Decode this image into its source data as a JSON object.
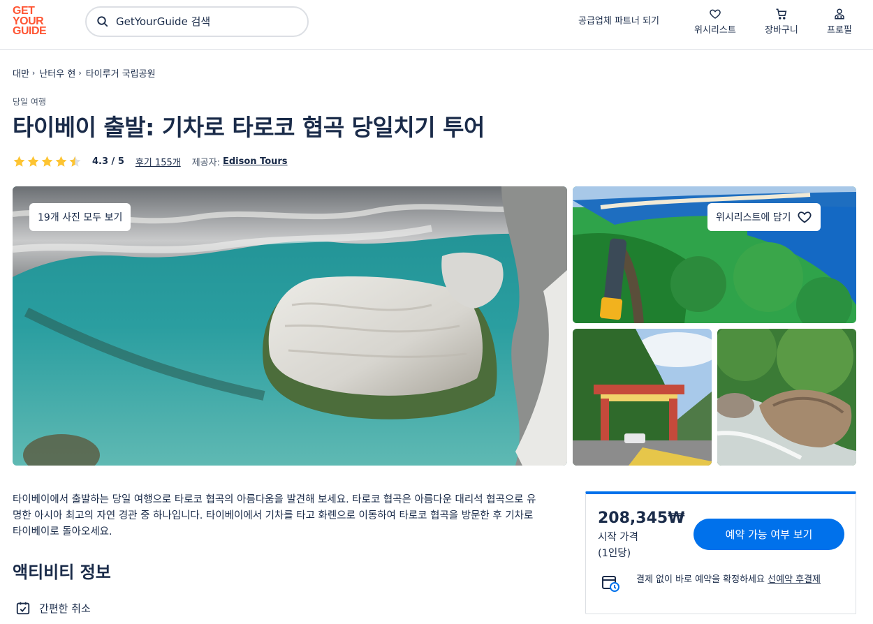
{
  "header": {
    "logo_lines": [
      "GET",
      "YOUR",
      "GUIDE"
    ],
    "search_placeholder": "GetYourGuide 검색",
    "partner_link": "공급업체 파트너 되기",
    "wishlist_label": "위시리스트",
    "cart_label": "장바구니",
    "profile_label": "프로필"
  },
  "breadcrumb": [
    "대만",
    "난터우 현",
    "타이루거 국립공원"
  ],
  "category": "당일 여행",
  "title": "타이베이 출발: 기차로 타로코 협곡 당일치기 투어",
  "rating": {
    "stars": 4.3,
    "score_text": "4.3 / 5",
    "reviews_text": "후기 155개",
    "provider_label": "제공자:",
    "provider_name": "Edison Tours"
  },
  "gallery": {
    "photos_button": "19개 사진 모두 보기",
    "wishlist_button": "위시리스트에 담기"
  },
  "description": "타이베이에서 출발하는 당일 여행으로 타로코 협곡의 아름다움을 발견해 보세요. 타로코 협곡은 아름다운 대리석 협곡으로 유명한 아시아 최고의 자연 경관 중 하나입니다. 타이베이에서 기차를 타고 화롄으로 이동하여 타로코 협곡을 방문한 후 기차로 타이베이로 돌아오세요.",
  "activity_info": {
    "title": "액티비티 정보",
    "features": [
      "간편한 취소"
    ]
  },
  "booking": {
    "price": "208,345₩",
    "price_label": "시작 가격",
    "price_unit": "(1인당)",
    "check_button": "예약 가능 여부 보기",
    "reserve_text": "결제 없이 바로 예약을 확정하세요 ",
    "reserve_link": "선예약 후결제"
  },
  "colors": {
    "brand": "#ff5533",
    "primary": "#0071eb",
    "text": "#1a2b49",
    "star": "#fdc432"
  }
}
